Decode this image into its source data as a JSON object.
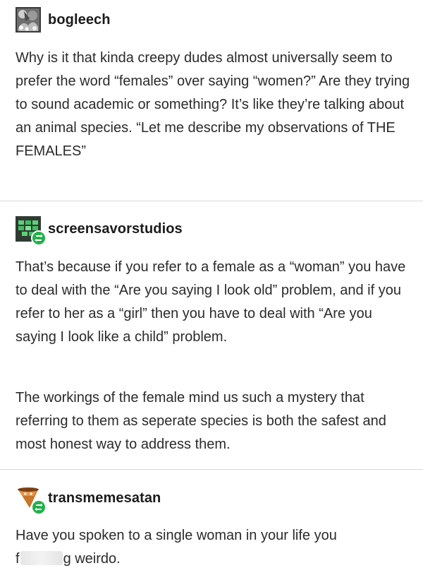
{
  "posts": [
    {
      "username": "bogleech",
      "avatar_icon": "bogleech-avatar-icon",
      "paragraphs": [
        "Why is it that kinda creepy dudes almost universally seem to prefer the word “females” over saying “women?” Are they trying to sound academic or something? It’s like they’re talking about an animal species. “Let me describe my observations of THE FEMALES”"
      ]
    },
    {
      "username": "screensavorstudios",
      "avatar_icon": "screensavor-avatar-icon",
      "reblog_icon": "reblog-icon",
      "paragraphs": [
        "That’s because if you refer to a female as a “woman” you have to deal with the “Are you saying I look old” problem, and if you refer to her as a “girl” then you have to deal with “Are you saying I look like a child” problem.",
        "The workings of the female mind us such a mystery that referring to them as seperate species is both the safest and most honest way to address them."
      ]
    },
    {
      "username": "transmemesatan",
      "avatar_icon": "transmemesatan-avatar-icon",
      "reblog_icon": "reblog-icon",
      "paragraphs": [
        "Have you spoken to a single woman in your life you"
      ],
      "last_line_start": "f",
      "last_line_end": "g weirdo."
    }
  ],
  "colors": {
    "reblog_green": "#21b049",
    "divider": "#d9d9d9",
    "text": "#2b2b2b"
  }
}
